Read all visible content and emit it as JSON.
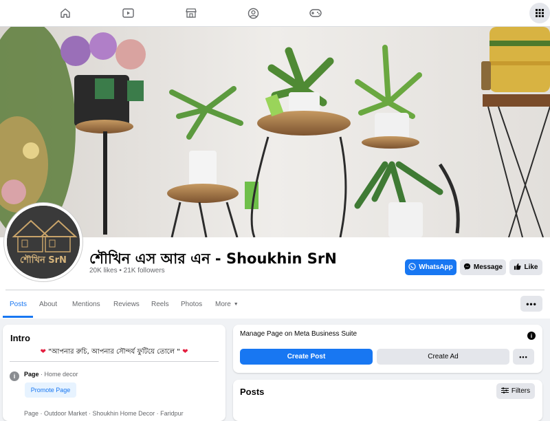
{
  "topnav": {
    "icons": [
      "home-icon",
      "video-icon",
      "marketplace-icon",
      "groups-icon",
      "gaming-icon"
    ],
    "menu_icon": "grid-menu-icon"
  },
  "profile": {
    "name": "শৌখিন এস আর এন - Shoukhin SrN",
    "stats": "20K likes • 21K followers",
    "avatar_text": "শৌখিন SrN"
  },
  "actions": {
    "whatsapp": "WhatsApp",
    "message": "Message",
    "like": "Like"
  },
  "tabs": [
    "Posts",
    "About",
    "Mentions",
    "Reviews",
    "Reels",
    "Photos",
    "More"
  ],
  "intro": {
    "title": "Intro",
    "tagline": "\"আপনার রুচি, আপনার সৌন্দর্য ফুটিয়ে তোলে \"",
    "page_label": "Page",
    "category": " · Home decor",
    "promote": "Promote Page",
    "cut_text": "Page · Outdoor Market · Shoukhin Home Decor · Faridpur"
  },
  "manage": {
    "title": "Manage Page on Meta Business Suite",
    "create_post": "Create Post",
    "create_ad": "Create Ad"
  },
  "posts": {
    "title": "Posts",
    "filters": "Filters"
  },
  "colors": {
    "accent": "#1877f2",
    "heart": "#e41e3f"
  }
}
